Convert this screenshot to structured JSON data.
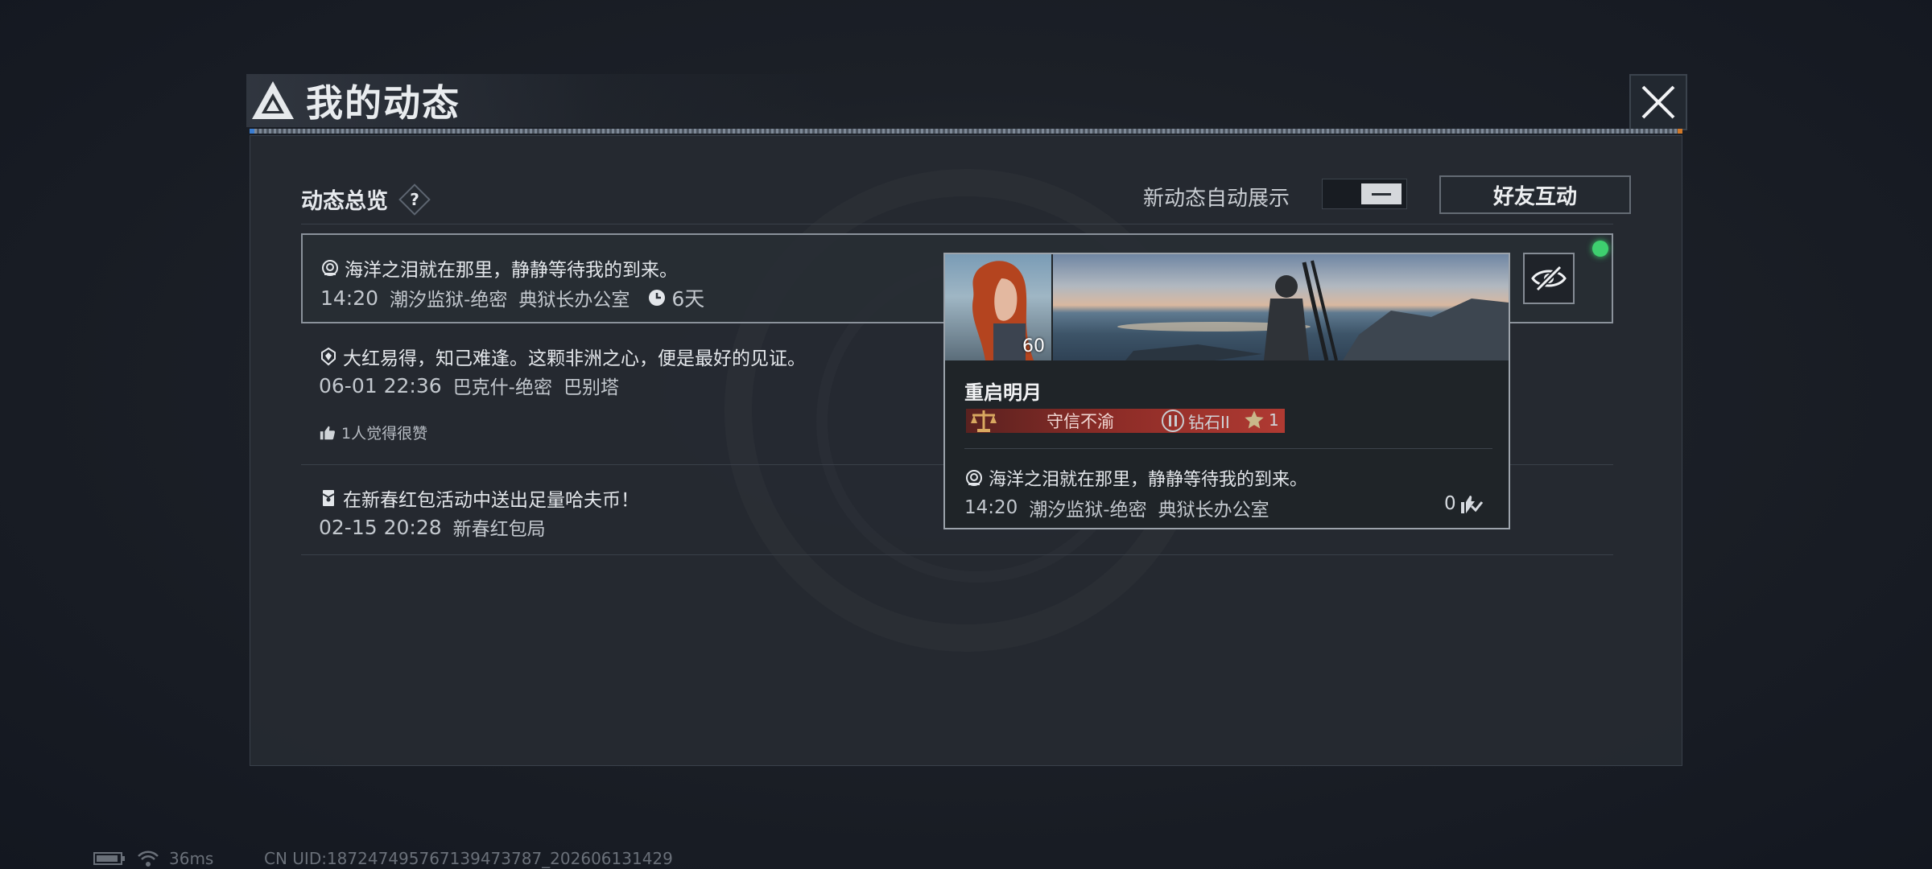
{
  "window": {
    "title": "我的动态"
  },
  "overview": {
    "section_title": "动态总览",
    "help_symbol": "?",
    "auto_show_label": "新动态自动展示",
    "friend_button": "好友互动"
  },
  "feed": [
    {
      "text": "海洋之泪就在那里，静静等待我的到来。",
      "time": "14:20",
      "map": "潮汐监狱-绝密",
      "location": "典狱长办公室",
      "duration": "6天",
      "icon": "diving-helmet-icon"
    },
    {
      "text": "大红易得，知己难逢。这颗非洲之心，便是最好的见证。",
      "time": "06-01 22:36",
      "map": "巴克什-绝密",
      "location": "巴别塔",
      "likes": "1人觉得很赞",
      "icon": "gem-icon"
    },
    {
      "text": "在新春红包活动中送出足量哈夫币！",
      "time": "02-15 20:28",
      "map": "新春红包局",
      "icon": "red-envelope-icon"
    }
  ],
  "card": {
    "level": "60",
    "name": "重启明月",
    "badge": "守信不渝",
    "rank": "钻石II",
    "stars": "1",
    "text": "海洋之泪就在那里，静静等待我的到来。",
    "time": "14:20",
    "map": "潮汐监狱-绝密",
    "location": "典狱长办公室",
    "likes": "0"
  },
  "status": {
    "ping": "36ms",
    "uid": "CN UID:187247495767139473787_202606131429"
  },
  "colors": {
    "online": "#3ecf6f",
    "badge_red": "#8c2c27",
    "accent_orange": "#d07828"
  }
}
